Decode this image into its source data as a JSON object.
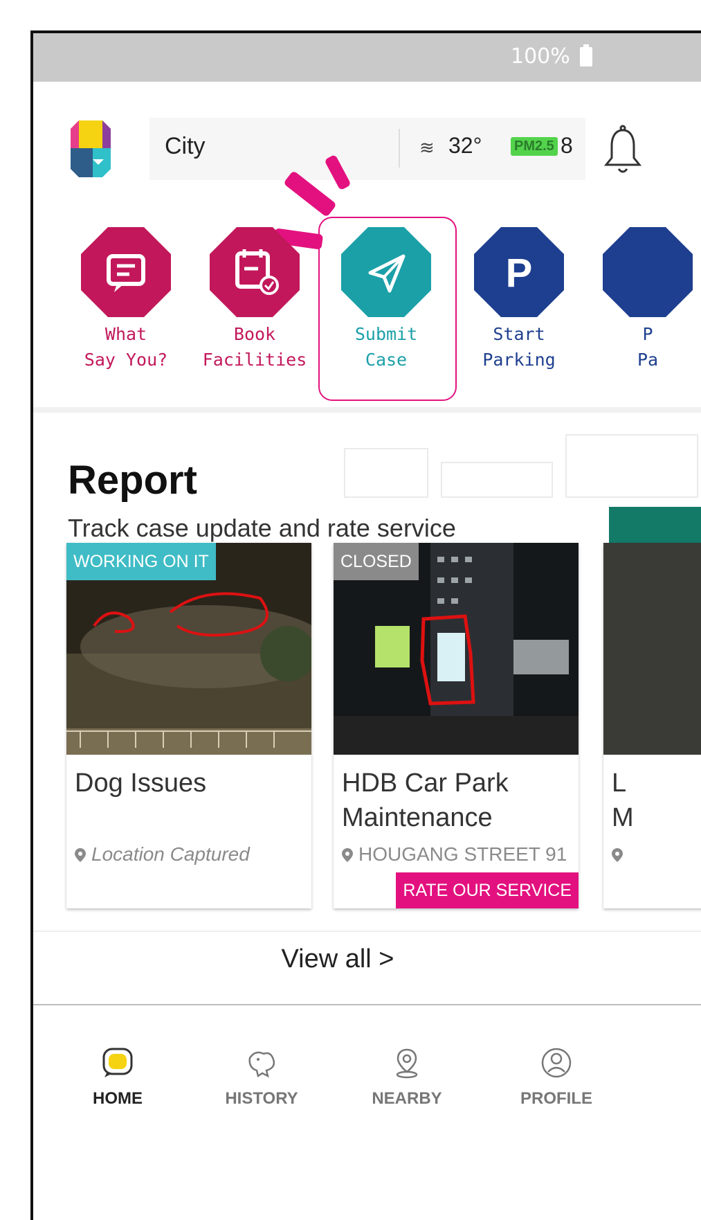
{
  "status_bar": {
    "battery": "100%"
  },
  "header": {
    "location": "City",
    "temperature": "32°",
    "pm_label": "PM2.5",
    "pm_value": "8"
  },
  "quick_actions": [
    {
      "label": "What\nSay You?",
      "icon": "message-icon",
      "color": "#c2185b"
    },
    {
      "label": "Book\nFacilities",
      "icon": "calendar-check-icon",
      "color": "#c2185b"
    },
    {
      "label": "Submit\nCase",
      "icon": "send-icon",
      "color": "#1ba0a8"
    },
    {
      "label": "Start\nParking",
      "icon": "parking-icon",
      "color": "#1e3f8f"
    },
    {
      "label": "P\nPa",
      "icon": "parking-icon",
      "color": "#1e3f8f"
    }
  ],
  "report": {
    "title": "Report",
    "subtitle": "Track case update and rate service"
  },
  "cards": [
    {
      "tag": "WORKING ON IT",
      "tag_color": "#3fbcc6",
      "title": "Dog Issues",
      "location": "Location Captured"
    },
    {
      "tag": "CLOSED",
      "tag_color": "#8a8a8a",
      "rate": "RATE OUR SERVICE",
      "title": "HDB Car Park Maintenance",
      "location": "HOUGANG STREET 91"
    },
    {
      "title": "L\nM",
      "location": ""
    }
  ],
  "view_all": "View all >",
  "nav": [
    {
      "label": "HOME",
      "icon": "home-chat-icon"
    },
    {
      "label": "HISTORY",
      "icon": "history-lion-icon"
    },
    {
      "label": "NEARBY",
      "icon": "map-pin-icon"
    },
    {
      "label": "PROFILE",
      "icon": "profile-icon"
    }
  ]
}
